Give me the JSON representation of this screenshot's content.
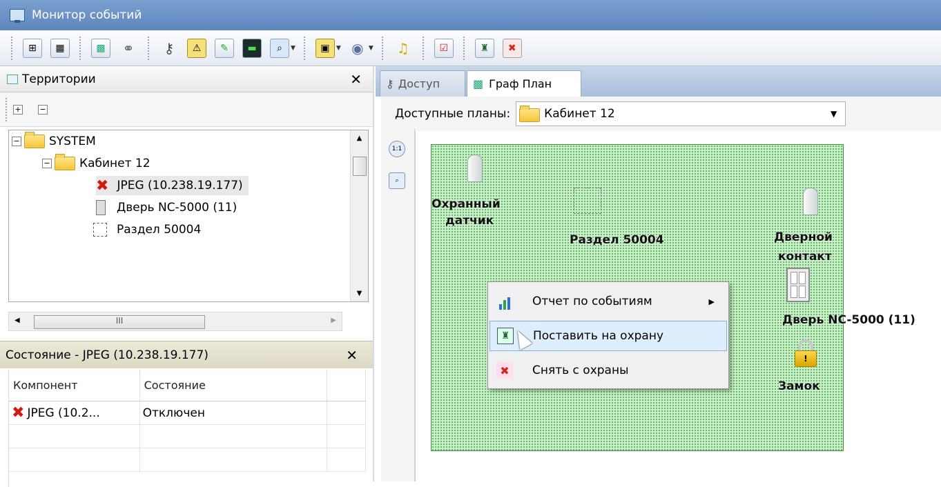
{
  "window": {
    "title": "Монитор событий"
  },
  "toolbar": {
    "buttons": [
      {
        "icon": "territory-icon"
      },
      {
        "icon": "grid-icon"
      },
      {
        "icon": "graph-plan-icon"
      },
      {
        "icon": "link-icon"
      },
      {
        "icon": "key-icon"
      },
      {
        "icon": "alarm-icon"
      },
      {
        "icon": "edit-icon"
      },
      {
        "icon": "console-icon"
      },
      {
        "icon": "zoom-icon"
      },
      {
        "icon": "export-icon"
      },
      {
        "icon": "camera-icon"
      },
      {
        "icon": "music-icon"
      },
      {
        "icon": "checklist-icon"
      },
      {
        "icon": "arm-icon"
      },
      {
        "icon": "disarm-icon"
      }
    ]
  },
  "territory_panel": {
    "title": "Территории",
    "expand_label": "+",
    "collapse_label": "−",
    "tree": {
      "root": "SYSTEM",
      "folder": "Кабинет 12",
      "items": [
        "JPEG (10.238.19.177)",
        "Дверь NC-5000 (11)",
        "Раздел 50004"
      ]
    },
    "hscroll_grip": "III"
  },
  "state_panel": {
    "title": "Состояние -  JPEG (10.238.19.177)",
    "columns": [
      "Компонент",
      "Состояние"
    ],
    "rows": [
      {
        "component": "JPEG (10.2...",
        "state": "Отключен"
      }
    ]
  },
  "tabs": [
    {
      "label": "Доступ",
      "active": false
    },
    {
      "label": "Граф План",
      "active": true
    }
  ],
  "plan": {
    "available_label": "Доступные планы:",
    "selected_plan": "Кабинет 12",
    "zoom_1_label": "1:1"
  },
  "canvas": {
    "labels": {
      "sensor1_line1": "Охранный",
      "sensor1_line2": "датчик",
      "section": "Раздел 50004",
      "sensor2_line1": "Дверной",
      "sensor2_line2": "контакт",
      "door": "Дверь NC-5000 (11)",
      "lock": "Замок"
    }
  },
  "context_menu": {
    "items": [
      {
        "label": "Отчет по событиям",
        "icon": "chart-icon",
        "submenu": true
      },
      {
        "label": "Поставить на охрану",
        "icon": "arm-icon",
        "highlighted": true
      },
      {
        "label": "Снять с охраны",
        "icon": "disarm-icon"
      }
    ]
  },
  "colors": {
    "canvas_green": "#cbeecb",
    "title_blue": "#6c93c8",
    "highlight": "#dfeefc"
  }
}
